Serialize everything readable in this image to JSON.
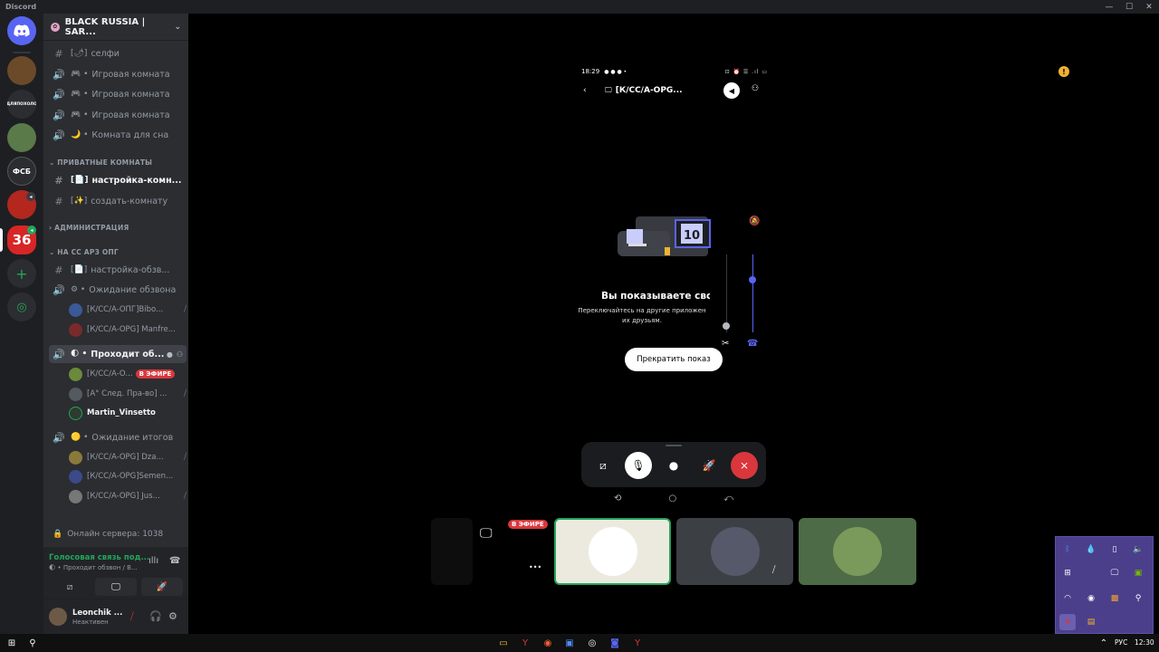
{
  "window": {
    "title": "Discord",
    "minimize": "—",
    "maximize": "☐",
    "close": "✕"
  },
  "rail": {
    "servers": [
      {
        "label": "",
        "bg": "#5865f2",
        "icon": "discord-logo"
      },
      {
        "label": "",
        "bg": "#6b4a2a",
        "icon": "server-avatar"
      },
      {
        "label": "ДЛЯПОХОЛО",
        "bg": "#2b2d31",
        "icon": "server-text"
      },
      {
        "label": "",
        "bg": "#5a7a4a",
        "icon": "server-avatar"
      },
      {
        "label": "ФСБ",
        "bg": "#2b2d31",
        "icon": "server-emblem"
      },
      {
        "label": "",
        "bg": "#b3271f",
        "icon": "server-avatar"
      },
      {
        "label": "36",
        "bg": "#d72626",
        "icon": "server-number"
      }
    ],
    "add_label": "+",
    "discover_label": "◎"
  },
  "guild": {
    "name": "BLACK RUSSIA | SAR...",
    "chevron": "⌄"
  },
  "channels": {
    "top": [
      {
        "icon": "#",
        "emoji": "[🌶]",
        "label": "селфи"
      },
      {
        "icon": "🔊",
        "emoji": "🎮 •",
        "label": "Игровая комната"
      },
      {
        "icon": "🔊",
        "emoji": "🎮 •",
        "label": "Игровая комната"
      },
      {
        "icon": "🔊",
        "emoji": "🎮 •",
        "label": "Игровая комната"
      },
      {
        "icon": "🔊",
        "emoji": "🌙 •",
        "label": "Комната для сна"
      }
    ],
    "cat_private": "ПРИВАТНЫЕ КОМНАТЫ",
    "private": [
      {
        "icon": "#",
        "emoji": "[📄]",
        "label": "настройка-комн..."
      },
      {
        "icon": "#",
        "emoji": "[✨]",
        "label": "создать-комнату"
      }
    ],
    "cat_admin": "АДМИНИСТРАЦИЯ",
    "cat_opg": "НА СС АРЗ ОПГ",
    "opg": {
      "setup": {
        "icon": "#",
        "emoji": "[📄]",
        "label": "настройка-обзв..."
      },
      "waiting": {
        "icon": "🔊",
        "emoji": "⚙ •",
        "label": "Ожидание обзвона"
      },
      "waiting_users": [
        {
          "name": "[К/СС/А-ОПГ]Bibo...",
          "color": "#3b5998"
        },
        {
          "name": "[К/СС/А-OPG] Manfre...",
          "color": "#7a2a2a"
        }
      ],
      "passing": {
        "icon": "🔊",
        "emoji": "🌓 •",
        "label": "Проходит об..."
      },
      "passing_users": [
        {
          "name": "[К/СС/А-О...",
          "color": "#6b8a3a",
          "badge": "В ЭФИРЕ"
        },
        {
          "name": "[А° След. Пра-во] ...",
          "color": "#555a60"
        },
        {
          "name": "Martin_Vinsetto",
          "color": "#2f3a30"
        }
      ],
      "results": {
        "icon": "🔊",
        "emoji": "🟡 •",
        "label": "Ожидание итогов"
      },
      "results_users": [
        {
          "name": "[К/СС/А-OPG] Dza...",
          "color": "#8a7a3a"
        },
        {
          "name": "[К/СС/А-OPG]Semen...",
          "color": "#3a4a8a"
        },
        {
          "name": "[К/СС/А-OPG] Jus...",
          "color": "#777"
        }
      ]
    },
    "online": "Онлайн сервера: 1038"
  },
  "voice": {
    "status": "Голосовая связь под...",
    "sub": "🌓 • Проходит обзвон / B..."
  },
  "me": {
    "name": "Leonchik ...",
    "status": "Неактивен"
  },
  "phone": {
    "time": "18:29",
    "status_icons": "⊡ ⏰ ☰ .ıl ▭",
    "channel": "[К/СС/А-OPG...",
    "back": "‹",
    "illustration_label": "10",
    "share_title": "Вы показываете свой",
    "share_sub_1": "Переключайтесь на другие приложен",
    "share_sub_2": "их друзьям.",
    "stop_button": "Прекратить показ"
  },
  "tiles": {
    "live": "В ЭФИРЕ",
    "more": "•••"
  },
  "taskbar": {
    "lang": "РУС",
    "time": "12:30"
  },
  "colors": {
    "accent": "#5865f2",
    "online": "#23a55a",
    "danger": "#da373c",
    "warning": "#f0b232",
    "tray": "#4b3f8c"
  }
}
